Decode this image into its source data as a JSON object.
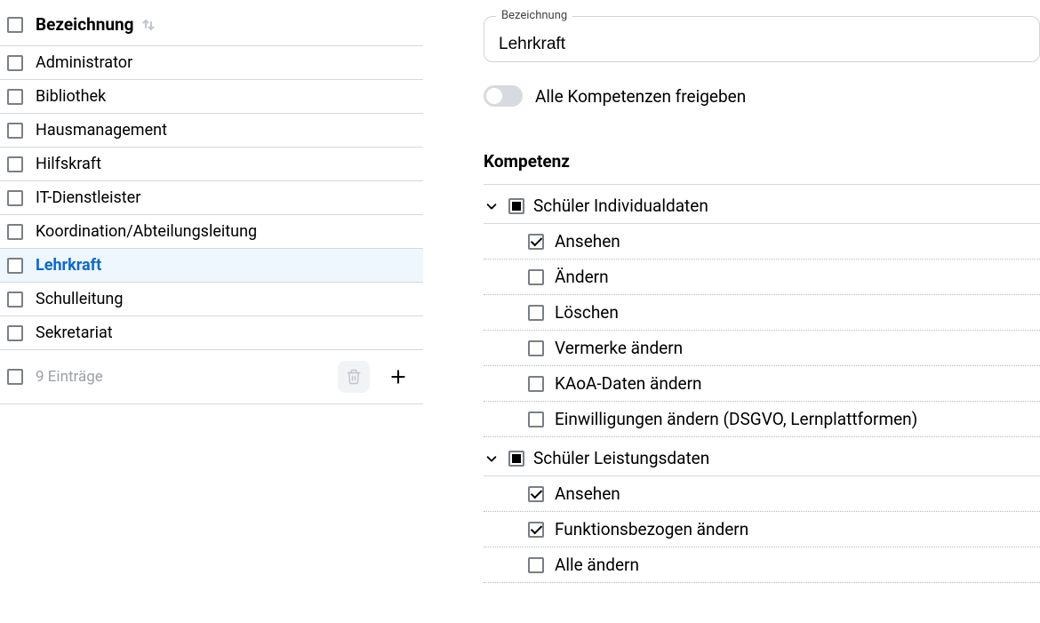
{
  "list": {
    "header": "Bezeichnung",
    "items": [
      {
        "label": "Administrator",
        "selected": false
      },
      {
        "label": "Bibliothek",
        "selected": false
      },
      {
        "label": "Hausmanagement",
        "selected": false
      },
      {
        "label": "Hilfskraft",
        "selected": false
      },
      {
        "label": "IT-Dienstleister",
        "selected": false
      },
      {
        "label": "Koordination/Abteilungsleitung",
        "selected": false
      },
      {
        "label": "Lehrkraft",
        "selected": true
      },
      {
        "label": "Schulleitung",
        "selected": false
      },
      {
        "label": "Sekretariat",
        "selected": false
      }
    ],
    "footer_count": "9 Einträge"
  },
  "detail": {
    "field_label": "Bezeichnung",
    "field_value": "Lehrkraft",
    "toggle_label": "Alle Kompetenzen freigeben",
    "toggle_on": false,
    "section_title": "Kompetenz",
    "groups": [
      {
        "label": "Schüler Individualdaten",
        "state": "indet",
        "items": [
          {
            "label": "Ansehen",
            "checked": true
          },
          {
            "label": "Ändern",
            "checked": false
          },
          {
            "label": "Löschen",
            "checked": false
          },
          {
            "label": "Vermerke ändern",
            "checked": false
          },
          {
            "label": "KAoA-Daten ändern",
            "checked": false
          },
          {
            "label": "Einwilligungen ändern (DSGVO, Lernplattformen)",
            "checked": false
          }
        ]
      },
      {
        "label": "Schüler Leistungsdaten",
        "state": "indet",
        "items": [
          {
            "label": "Ansehen",
            "checked": true
          },
          {
            "label": "Funktionsbezogen ändern",
            "checked": true
          },
          {
            "label": "Alle ändern",
            "checked": false
          }
        ]
      }
    ]
  }
}
